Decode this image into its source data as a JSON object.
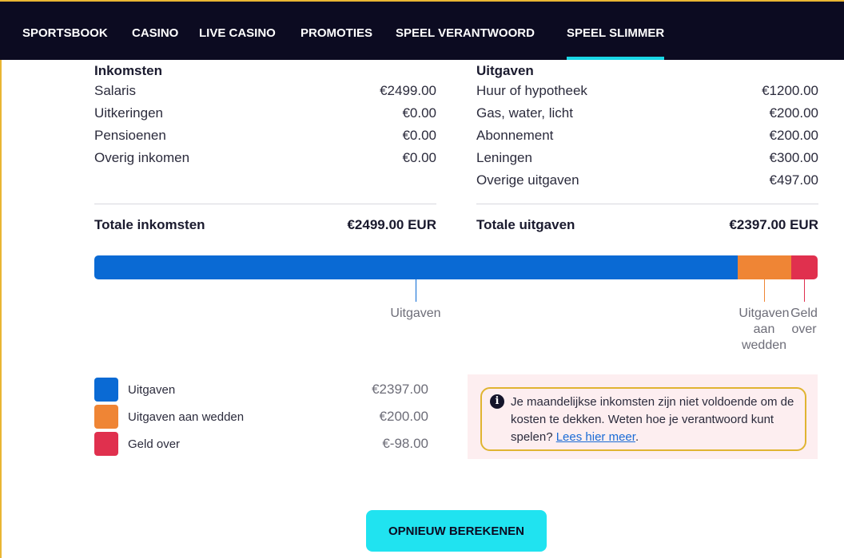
{
  "nav": {
    "items": [
      "SPORTSBOOK",
      "CASINO",
      "LIVE CASINO",
      "PROMOTIES",
      "SPEEL VERANTWOORD",
      "SPEEL SLIMMER"
    ],
    "active": "SPEEL SLIMMER"
  },
  "income": {
    "title": "Inkomsten",
    "rows": [
      {
        "label": "Salaris",
        "amount": "€2499.00"
      },
      {
        "label": "Uitkeringen",
        "amount": "€0.00"
      },
      {
        "label": "Pensioenen",
        "amount": "€0.00"
      },
      {
        "label": "Overig inkomen",
        "amount": "€0.00"
      }
    ],
    "total_label": "Totale inkomsten",
    "total_amount": "€2499.00 EUR"
  },
  "expenses": {
    "title": "Uitgaven",
    "rows": [
      {
        "label": "Huur of hypotheek",
        "amount": "€1200.00"
      },
      {
        "label": "Gas, water, licht",
        "amount": "€200.00"
      },
      {
        "label": "Abonnement",
        "amount": "€200.00"
      },
      {
        "label": "Leningen",
        "amount": "€300.00"
      },
      {
        "label": "Overige uitgaven",
        "amount": "€497.00"
      }
    ],
    "total_label": "Totale uitgaven",
    "total_amount": "€2397.00 EUR"
  },
  "breakdown_bar": {
    "segments": [
      {
        "key": "uitgaven",
        "fraction": 0.889,
        "color": "#0a6ad4"
      },
      {
        "key": "wedden",
        "fraction": 0.074,
        "color": "#ef8535"
      },
      {
        "key": "geld_over",
        "fraction": 0.037,
        "color": "#e0304e"
      }
    ],
    "labels": {
      "uitgaven": "Uitgaven",
      "wedden": "Uitgaven aan wedden",
      "geld_over": "Geld over"
    }
  },
  "legend": [
    {
      "label": "Uitgaven",
      "value": "€2397.00",
      "color": "#0a6ad4"
    },
    {
      "label": "Uitgaven aan wedden",
      "value": "€200.00",
      "color": "#ef8535"
    },
    {
      "label": "Geld over",
      "value": "€-98.00",
      "color": "#e0304e"
    }
  ],
  "info": {
    "icon": "info-icon",
    "text": "Je maandelijkse inkomsten zijn niet voldoende om de kosten te dekken. Weten hoe je verantwoord kunt spelen?",
    "link": "Lees hier meer",
    "after_link": "."
  },
  "recalc_button": "OPNIEUW BEREKENEN",
  "colors": {
    "nav_bg": "#0c0b21",
    "accent": "#1ad7e6",
    "frame": "#e9b633",
    "button": "#20e3f0"
  }
}
